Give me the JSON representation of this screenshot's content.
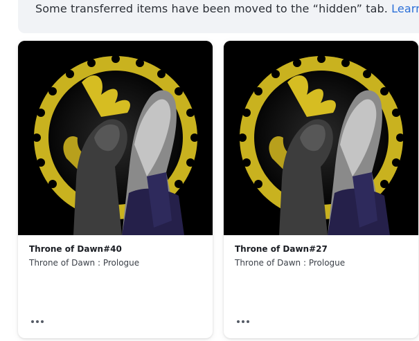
{
  "notice": {
    "text": "Some transferred items have been moved to the “hidden” tab.",
    "link_label": "Learn more"
  },
  "cards": [
    {
      "title": "Throne of Dawn#40",
      "collection": "Throne of Dawn : Prologue",
      "image": "throne-of-dawn-artwork",
      "more_icon": "more-horizontal-icon"
    },
    {
      "title": "Throne of Dawn#27",
      "collection": "Throne of Dawn : Prologue",
      "image": "throne-of-dawn-artwork",
      "more_icon": "more-horizontal-icon"
    }
  ],
  "colors": {
    "notice_background": "#f1f3f6",
    "link": "#2b6fd8",
    "artwork_background": "#000000",
    "artwork_ring": "#c9b21f"
  }
}
